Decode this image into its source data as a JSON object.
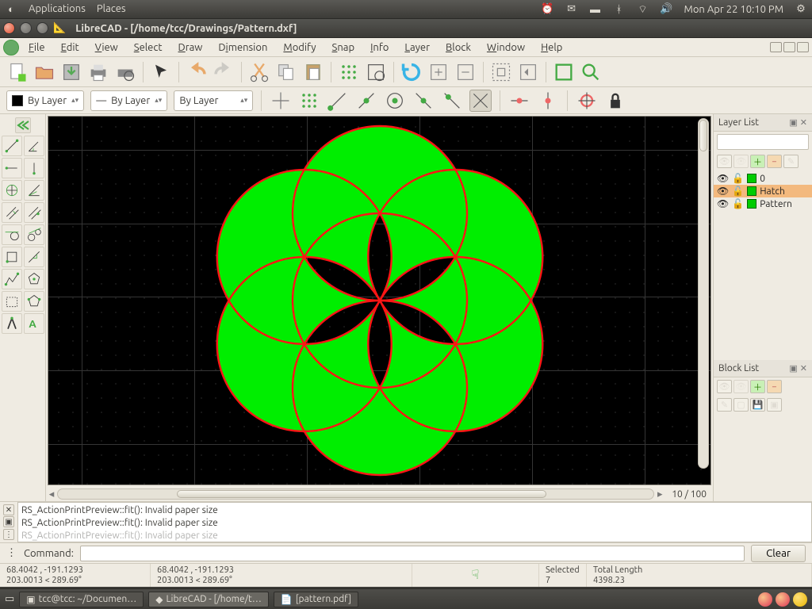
{
  "topbar": {
    "apps": "Applications",
    "places": "Places",
    "clock": "Mon Apr 22  10:10 PM"
  },
  "window": {
    "title": "LibreCAD - [/home/tcc/Drawings/Pattern.dxf]"
  },
  "menu": [
    "File",
    "Edit",
    "View",
    "Select",
    "Draw",
    "Dimension",
    "Modify",
    "Snap",
    "Info",
    "Layer",
    "Block",
    "Window",
    "Help"
  ],
  "combos": {
    "color": "By Layer",
    "line": "By Layer",
    "width": "By Layer"
  },
  "zoom": "10 / 100",
  "layerlist": {
    "title": "Layer List",
    "items": [
      {
        "name": "0",
        "selected": false
      },
      {
        "name": "Hatch",
        "selected": true
      },
      {
        "name": "Pattern",
        "selected": false
      }
    ]
  },
  "blocklist": {
    "title": "Block List"
  },
  "console": {
    "lines": [
      "RS_ActionPrintPreview::fit(): Invalid paper size",
      "RS_ActionPrintPreview::fit(): Invalid paper size",
      "RS_ActionPrintPreview::fit(): Invalid paper size"
    ]
  },
  "command": {
    "label": "Command:",
    "clear": "Clear"
  },
  "status": {
    "abs1": "68.4042 , -191.1293",
    "rel1": "203.0013 < 289.69°",
    "abs2": "68.4042 , -191.1293",
    "rel2": "203.0013 < 289.69°",
    "sel_label": "Selected",
    "sel_val": "7",
    "len_label": "Total Length",
    "len_val": "4398.23"
  },
  "taskbar": {
    "items": [
      "tcc@tcc: ~/Documen…",
      "LibreCAD - [/home/t…",
      "[pattern.pdf]"
    ]
  }
}
